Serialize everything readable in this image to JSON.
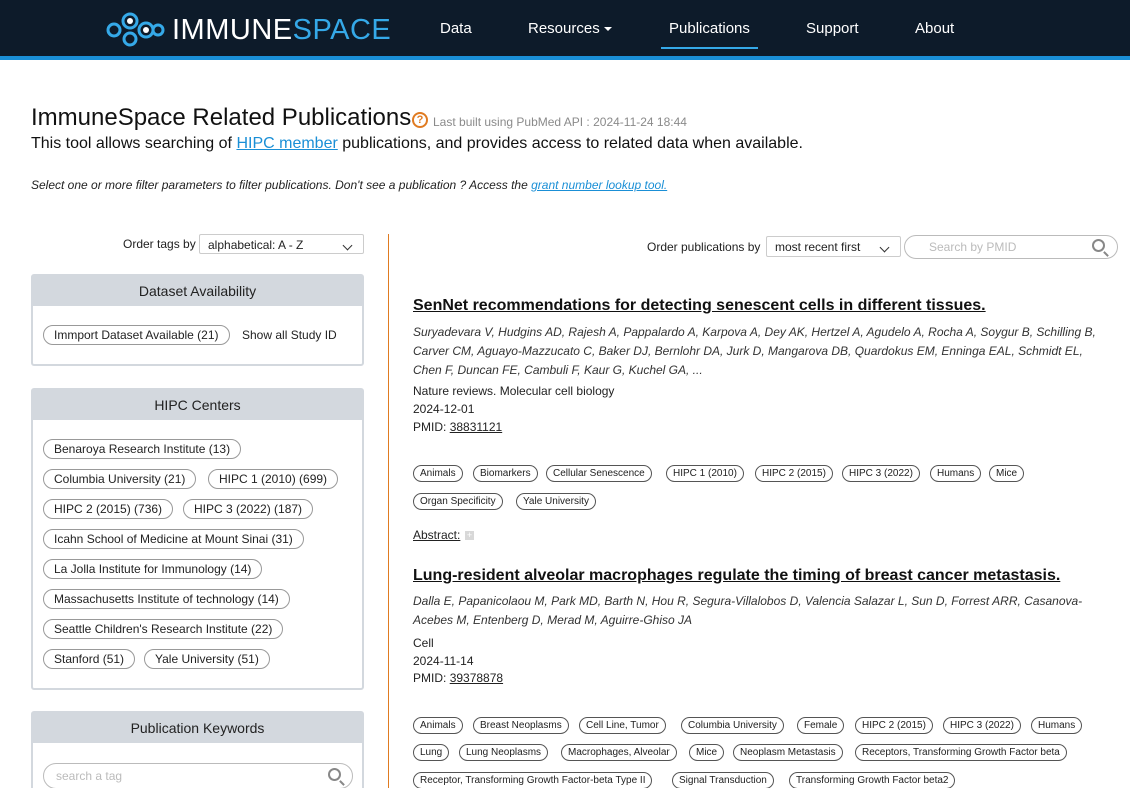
{
  "nav": {
    "logo_white": "IMMUNE",
    "logo_blue": "SPACE",
    "items": [
      {
        "label": "Data"
      },
      {
        "label": "Resources"
      },
      {
        "label": "Publications"
      },
      {
        "label": "Support"
      },
      {
        "label": "About"
      }
    ]
  },
  "header": {
    "title": "ImmuneSpace Related Publications",
    "help": "?",
    "last_built": "Last built using PubMed API : 2024-11-24 18:44",
    "intro_before": "This tool allows searching of ",
    "intro_link": "HIPC member",
    "intro_after": " publications, and provides access to related data when available.",
    "hint_before": "Select one or more filter parameters to filter publications. Don't see a publication ? Access the ",
    "hint_link": "grant number lookup tool."
  },
  "left": {
    "order_tags_label": "Order tags by",
    "order_tags_value": "alphabetical: A - Z",
    "dataset": {
      "heading": "Dataset Availability",
      "tag": "Immport Dataset Available (21)",
      "show_all": "Show all Study ID"
    },
    "centers": {
      "heading": "HIPC Centers",
      "tags": [
        "Benaroya Research Institute (13)",
        "Columbia University (21)",
        "HIPC 1 (2010) (699)",
        "HIPC 2 (2015) (736)",
        "HIPC 3 (2022) (187)",
        "Icahn School of Medicine at Mount Sinai (31)",
        "La Jolla Institute for Immunology (14)",
        "Massachusetts Institute of technology (14)",
        "Seattle Children's Research Institute (22)",
        "Stanford (51)",
        "Yale University (51)"
      ]
    },
    "keywords": {
      "heading": "Publication Keywords",
      "search_placeholder": "search a tag"
    }
  },
  "right": {
    "order_pubs_label": "Order publications by",
    "order_pubs_value": "most recent first",
    "pmid_placeholder": "Search by PMID",
    "pubs": [
      {
        "title": "SenNet recommendations for detecting senescent cells in different tissues.",
        "authors": "Suryadevara V, Hudgins AD, Rajesh A, Pappalardo A, Karpova A, Dey AK, Hertzel A, Agudelo A, Rocha A, Soygur B, Schilling B, Carver CM, Aguayo-Mazzucato C, Baker DJ, Bernlohr DA, Jurk D, Mangarova DB, Quardokus EM, Enninga EAL, Schmidt EL, Chen F, Duncan FE, Cambuli F, Kaur G, Kuchel GA, ...",
        "journal": "Nature reviews. Molecular cell biology",
        "date": "2024-12-01",
        "pmid_label": "PMID:",
        "pmid": "38831121",
        "tags": [
          "Animals",
          "Biomarkers",
          "Cellular Senescence",
          "HIPC 1 (2010)",
          "HIPC 2 (2015)",
          "HIPC 3 (2022)",
          "Humans",
          "Mice",
          "Organ Specificity",
          "Yale University"
        ],
        "abstract": "Abstract:"
      },
      {
        "title": "Lung-resident alveolar macrophages regulate the timing of breast cancer metastasis.",
        "authors": "Dalla E, Papanicolaou M, Park MD, Barth N, Hou R, Segura-Villalobos D, Valencia Salazar L, Sun D, Forrest ARR, Casanova-Acebes M, Entenberg D, Merad M, Aguirre-Ghiso JA",
        "journal": "Cell",
        "date": "2024-11-14",
        "pmid_label": "PMID:",
        "pmid": "39378878",
        "tags": [
          "Animals",
          "Breast Neoplasms",
          "Cell Line, Tumor",
          "Columbia University",
          "Female",
          "HIPC 2 (2015)",
          "HIPC 3 (2022)",
          "Humans",
          "Lung",
          "Lung Neoplasms",
          "Macrophages, Alveolar",
          "Mice",
          "Neoplasm Metastasis",
          "Receptors, Transforming Growth Factor beta",
          "Receptor, Transforming Growth Factor-beta Type II",
          "Signal Transduction",
          "Transforming Growth Factor beta2"
        ]
      }
    ]
  },
  "colors": {
    "nav_bg": "#0d1b2a",
    "accent": "#1a8fd6",
    "orange": "#e07b21"
  }
}
